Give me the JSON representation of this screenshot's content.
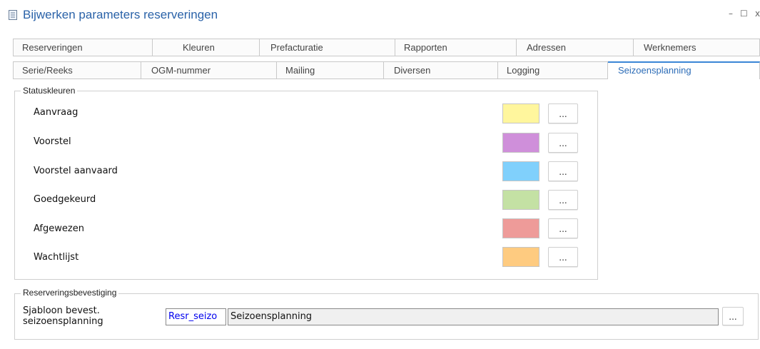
{
  "window": {
    "title": "Bijwerken parameters reserveringen",
    "minimize_glyph": "–",
    "maximize_glyph": "☐",
    "close_glyph": "x"
  },
  "tabs": {
    "row1": [
      "Reserveringen",
      "Kleuren",
      "Prefacturatie",
      "Rapporten",
      "Adressen",
      "Werknemers"
    ],
    "row2": [
      "Serie/Reeks",
      "OGM-nummer",
      "Mailing",
      "Diversen",
      "Logging",
      "Seizoensplanning"
    ],
    "active": "Seizoensplanning"
  },
  "statuskleuren": {
    "legend": "Statuskleuren",
    "items": [
      {
        "label": "Aanvraag",
        "color": "#fff69d"
      },
      {
        "label": "Voorstel",
        "color": "#cf8fda"
      },
      {
        "label": "Voorstel aanvaard",
        "color": "#80d0fc"
      },
      {
        "label": "Goedgekeurd",
        "color": "#c4e1a4"
      },
      {
        "label": "Afgewezen",
        "color": "#ee9b99"
      },
      {
        "label": "Wachtlijst",
        "color": "#fecb80"
      }
    ],
    "browse_label": "..."
  },
  "bevestiging": {
    "legend": "Reserveringsbevestiging",
    "label_line1": "Sjabloon bevest.",
    "label_line2": "seizoensplanning",
    "code": "Resr_seizo",
    "description": "Seizoensplanning",
    "browse_label": "..."
  },
  "colors": {
    "title": "#2a62a8",
    "active_tab_text": "#2c6cb7",
    "active_tab_border": "#3a86d6",
    "code_text": "#0000ee"
  }
}
